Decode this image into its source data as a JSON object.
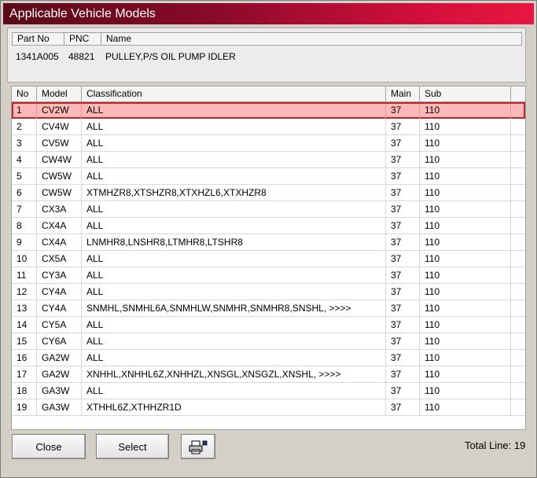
{
  "window": {
    "title": "Applicable Vehicle Models"
  },
  "part_header": {
    "part_no": "Part No",
    "pnc": "PNC",
    "name": "Name"
  },
  "part": {
    "part_no": "1341A005",
    "pnc": "48821",
    "name": "PULLEY,P/S OIL PUMP IDLER"
  },
  "columns": {
    "no": "No",
    "model": "Model",
    "classification": "Classification",
    "main": "Main",
    "sub": "Sub"
  },
  "rows": [
    {
      "no": "1",
      "model": "CV2W",
      "classification": "ALL",
      "main": "37",
      "sub": "110"
    },
    {
      "no": "2",
      "model": "CV4W",
      "classification": "ALL",
      "main": "37",
      "sub": "110"
    },
    {
      "no": "3",
      "model": "CV5W",
      "classification": "ALL",
      "main": "37",
      "sub": "110"
    },
    {
      "no": "4",
      "model": "CW4W",
      "classification": "ALL",
      "main": "37",
      "sub": "110"
    },
    {
      "no": "5",
      "model": "CW5W",
      "classification": "ALL",
      "main": "37",
      "sub": "110"
    },
    {
      "no": "6",
      "model": "CW5W",
      "classification": "XTMHZR8,XTSHZR8,XTXHZL6,XTXHZR8",
      "main": "37",
      "sub": "110"
    },
    {
      "no": "7",
      "model": "CX3A",
      "classification": "ALL",
      "main": "37",
      "sub": "110"
    },
    {
      "no": "8",
      "model": "CX4A",
      "classification": "ALL",
      "main": "37",
      "sub": "110"
    },
    {
      "no": "9",
      "model": "CX4A",
      "classification": "LNMHR8,LNSHR8,LTMHR8,LTSHR8",
      "main": "37",
      "sub": "110"
    },
    {
      "no": "10",
      "model": "CX5A",
      "classification": "ALL",
      "main": "37",
      "sub": "110"
    },
    {
      "no": "11",
      "model": "CY3A",
      "classification": "ALL",
      "main": "37",
      "sub": "110"
    },
    {
      "no": "12",
      "model": "CY4A",
      "classification": "ALL",
      "main": "37",
      "sub": "110"
    },
    {
      "no": "13",
      "model": "CY4A",
      "classification": "SNMHL,SNMHL6A,SNMHLW,SNMHR,SNMHR8,SNSHL,  >>>>",
      "main": "37",
      "sub": "110"
    },
    {
      "no": "14",
      "model": "CY5A",
      "classification": "ALL",
      "main": "37",
      "sub": "110"
    },
    {
      "no": "15",
      "model": "CY6A",
      "classification": "ALL",
      "main": "37",
      "sub": "110"
    },
    {
      "no": "16",
      "model": "GA2W",
      "classification": "ALL",
      "main": "37",
      "sub": "110"
    },
    {
      "no": "17",
      "model": "GA2W",
      "classification": "XNHHL,XNHHL6Z,XNHHZL,XNSGL,XNSGZL,XNSHL,  >>>>",
      "main": "37",
      "sub": "110"
    },
    {
      "no": "18",
      "model": "GA3W",
      "classification": "ALL",
      "main": "37",
      "sub": "110"
    },
    {
      "no": "19",
      "model": "GA3W",
      "classification": "XTHHL6Z,XTHHZR1D",
      "main": "37",
      "sub": "110"
    }
  ],
  "selected_row": 0,
  "buttons": {
    "close": "Close",
    "select": "Select"
  },
  "footer": {
    "total_line": "Total Line: 19"
  },
  "colors": {
    "title_dark": "#5a0a18",
    "title_light": "#e8173f",
    "selection_fill": "#ffb8b8",
    "selection_border": "#c0262c"
  }
}
